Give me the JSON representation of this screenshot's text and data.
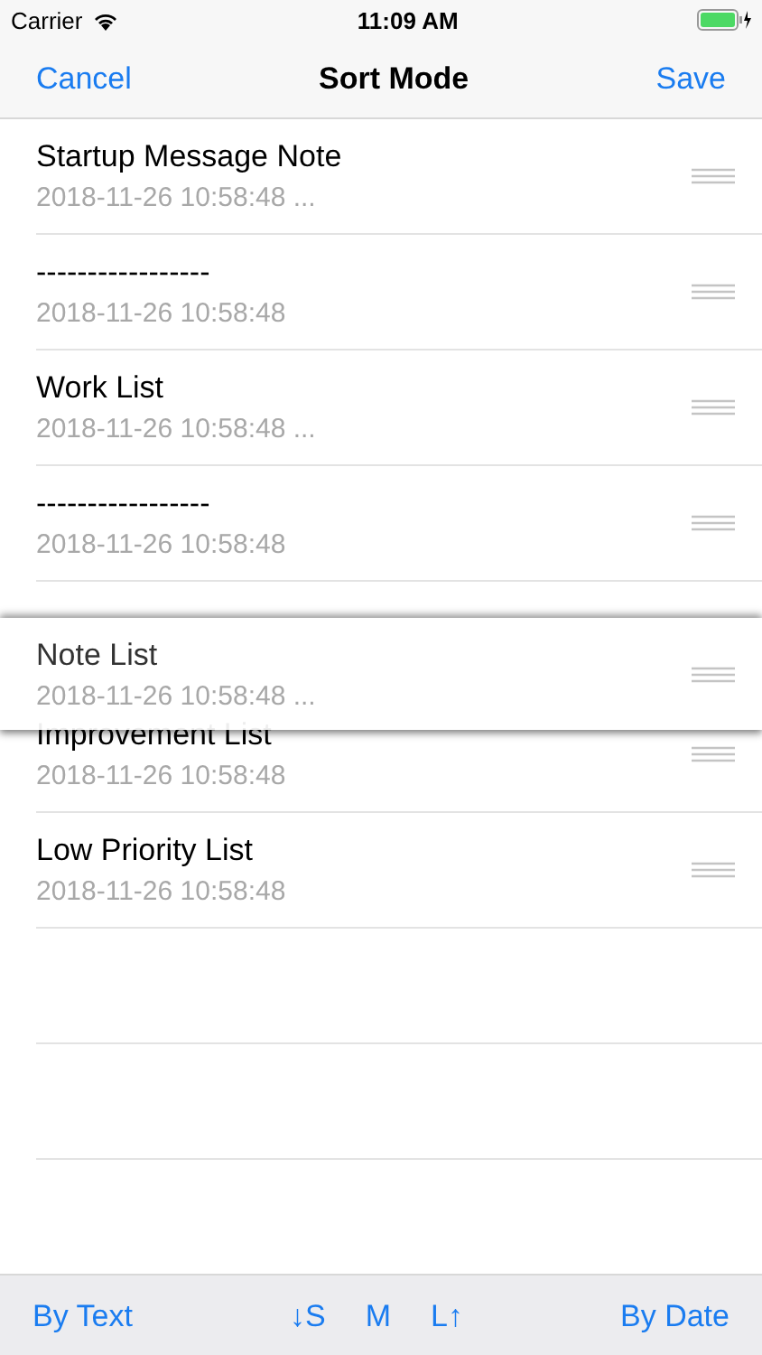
{
  "status_bar": {
    "carrier": "Carrier",
    "time": "11:09 AM"
  },
  "nav": {
    "cancel": "Cancel",
    "title": "Sort Mode",
    "save": "Save"
  },
  "rows": [
    {
      "kind": "note",
      "title": "Startup Message Note",
      "date": "2018-11-26 10:58:48 ..."
    },
    {
      "kind": "note",
      "title": "-----------------",
      "date": "2018-11-26 10:58:48"
    },
    {
      "kind": "note",
      "title": "Work List",
      "date": "2018-11-26 10:58:48 ..."
    },
    {
      "kind": "note",
      "title": "-----------------",
      "date": "2018-11-26 10:58:48"
    },
    {
      "kind": "gap"
    },
    {
      "kind": "note",
      "title": "Improvement List",
      "date": "2018-11-26 10:58:48"
    },
    {
      "kind": "note",
      "title": "Low Priority List",
      "date": "2018-11-26 10:58:48"
    }
  ],
  "dragged_row": {
    "title": "Note List",
    "date": "2018-11-26 10:58:48 ..."
  },
  "toolbar": {
    "left": "By Text",
    "middle": [
      "↓S",
      "M",
      "L↑"
    ],
    "right": "By Date"
  }
}
